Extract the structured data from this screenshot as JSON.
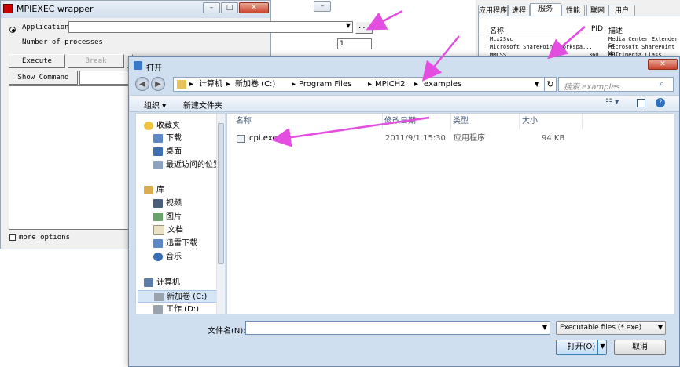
{
  "mpiexec": {
    "title": "MPIEXEC wrapper",
    "application_label": "Application",
    "processes_label": "Number of processes",
    "processes_value": "1",
    "browse_label": "...",
    "execute_label": "Execute",
    "break_label": "Break",
    "show_command_label": "Show Command",
    "more_options_label": "more options"
  },
  "taskmgr": {
    "tabs": [
      "应用程序",
      "进程",
      "服务",
      "性能",
      "联网",
      "用户"
    ],
    "columns": {
      "name": "名称",
      "pid": "PID",
      "desc": "描述"
    },
    "rows": [
      {
        "name": "Mcx2Svc",
        "pid": "",
        "desc": "Media Center Extender Se"
      },
      {
        "name": "Microsoft SharePoint Workspa...",
        "pid": "",
        "desc": "Microsoft SharePoint Wor"
      },
      {
        "name": "MMCSS",
        "pid": "360",
        "desc": "Multimedia Class Schedul"
      }
    ]
  },
  "dialog": {
    "title": "打开",
    "breadcrumb": [
      "计算机",
      "新加卷 (C:)",
      "Program Files",
      "MPICH2",
      "examples"
    ],
    "search_placeholder": "搜索 examples",
    "organize_label": "组织 ▾",
    "new_folder_label": "新建文件夹",
    "sidebar": {
      "favorites_label": "收藏夹",
      "favorites": [
        "下载",
        "桌面",
        "最近访问的位置"
      ],
      "libraries_label": "库",
      "libraries": [
        "视频",
        "图片",
        "文档",
        "迅雷下载",
        "音乐"
      ],
      "computer_label": "计算机",
      "drives": [
        "新加卷 (C:)",
        "工作 (D:)"
      ]
    },
    "columns": {
      "name": "名称",
      "date": "修改日期",
      "type": "类型",
      "size": "大小"
    },
    "files": [
      {
        "name": "cpi.exe",
        "date": "2011/9/1 15:30",
        "type": "应用程序",
        "size": "94 KB"
      }
    ],
    "filename_label": "文件名(N):",
    "filename_value": "",
    "filter_label": "Executable files (*.exe)",
    "open_label": "打开(O)",
    "cancel_label": "取消"
  },
  "colors": {
    "arrow": "#e34ee0",
    "dialog_chrome": "#cfdff0",
    "selected": "#d7e6f7"
  }
}
